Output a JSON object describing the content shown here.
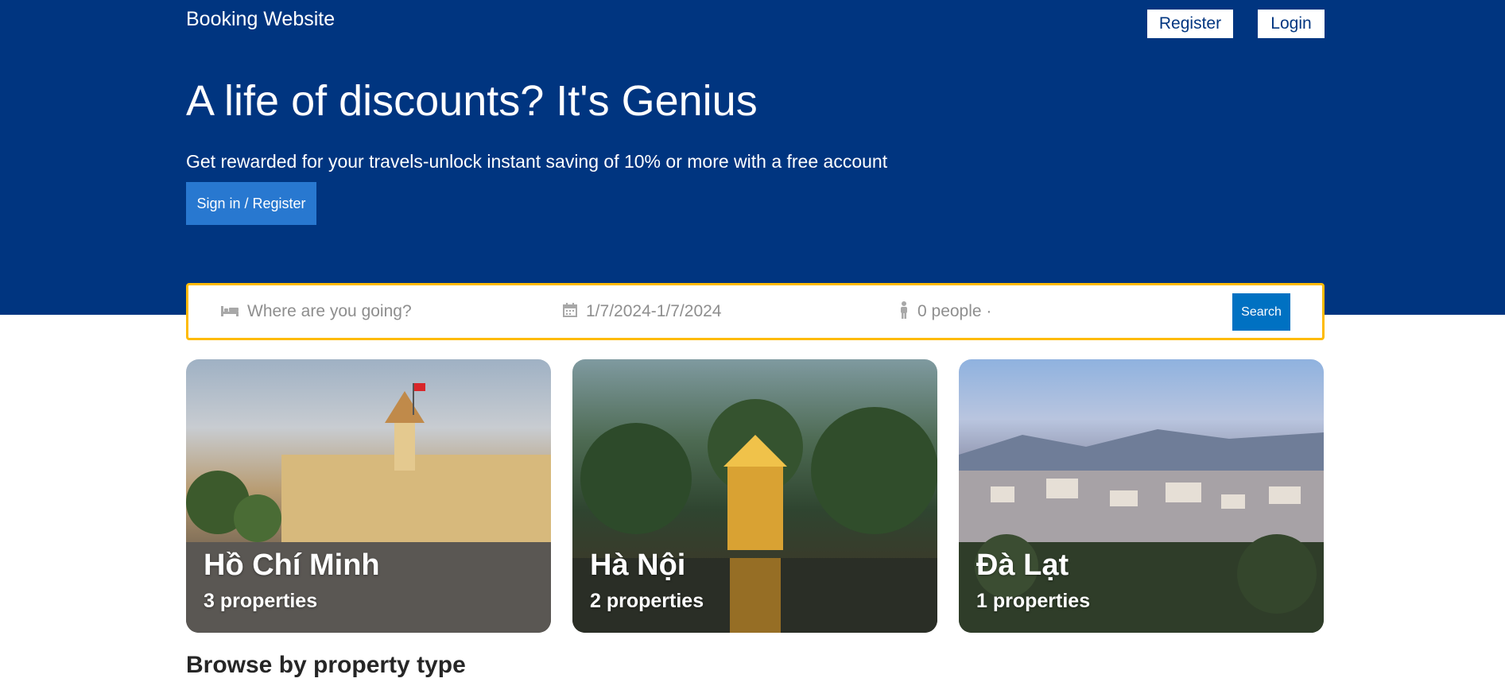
{
  "header": {
    "brand": "Booking Website",
    "register_label": "Register",
    "login_label": "Login"
  },
  "hero": {
    "title": "A life of discounts? It's Genius",
    "subtitle": "Get rewarded for your travels-unlock instant saving of 10% or more with a free account",
    "cta_label": "Sign in / Register"
  },
  "search": {
    "destination_placeholder": "Where are you going?",
    "date_value": "1/7/2024-1/7/2024",
    "people_value": "0 people ·",
    "button_label": "Search",
    "icons": {
      "destination": "bed-icon",
      "date": "calendar-icon",
      "people": "person-icon"
    }
  },
  "cities": [
    {
      "name": "Hồ Chí Minh",
      "count": "3 properties"
    },
    {
      "name": "Hà Nội",
      "count": "2 properties"
    },
    {
      "name": "Đà Lạt",
      "count": "1 properties"
    }
  ],
  "sections": {
    "property_type_title": "Browse by property type"
  },
  "colors": {
    "primary": "#003580",
    "cta": "#2878d0",
    "search_button": "#0071c2",
    "search_border": "#febb02"
  }
}
